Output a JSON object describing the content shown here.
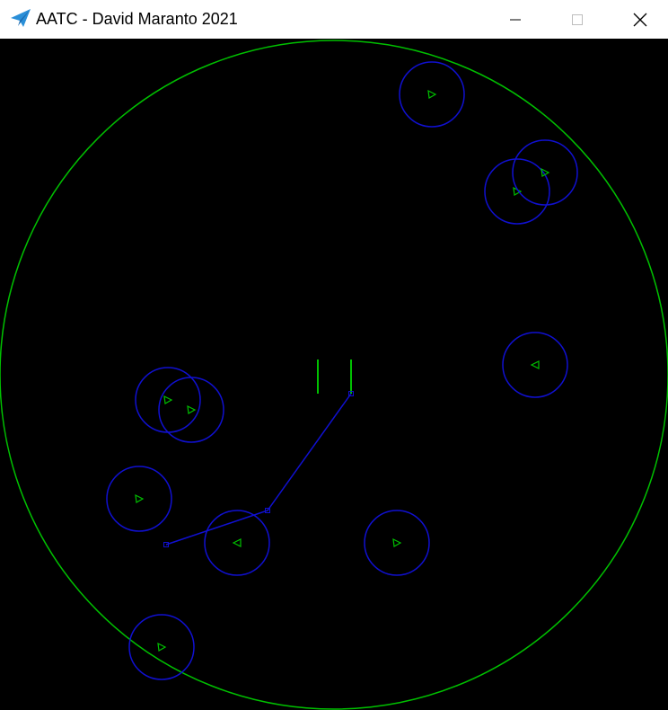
{
  "window": {
    "title": "AATC - David Maranto 2021",
    "controls": [
      "minimize-button",
      "maximize-button",
      "close-button"
    ]
  },
  "colors": {
    "radar_boundary": "#00c000",
    "separation_ring": "#1010d0",
    "aircraft_marker": "#00c000",
    "route_line": "#1010d0",
    "runway": "#00c000",
    "background": "#000000",
    "titlebar": "#ffffff",
    "app_icon": "#2a8fd8"
  },
  "icons": {
    "app": "paper-plane-icon",
    "minimize": "minimize-icon",
    "maximize": "maximize-icon",
    "close": "close-icon"
  }
}
